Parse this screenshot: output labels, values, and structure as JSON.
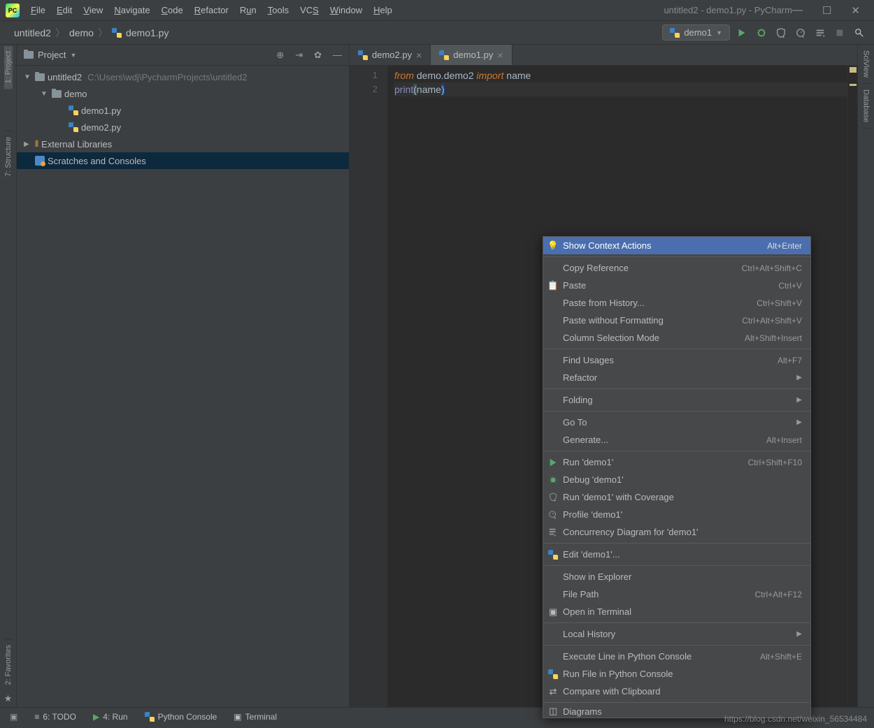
{
  "window": {
    "title": "untitled2 - demo1.py - PyCharm"
  },
  "menu": {
    "file": "File",
    "edit": "Edit",
    "view": "View",
    "navigate": "Navigate",
    "code": "Code",
    "refactor": "Refactor",
    "run": "Run",
    "tools": "Tools",
    "vcs": "VCS",
    "window": "Window",
    "help": "Help"
  },
  "breadcrumb": {
    "root": "untitled2",
    "folder": "demo",
    "file": "demo1.py"
  },
  "run_config": {
    "name": "demo1"
  },
  "project_panel": {
    "title": "Project"
  },
  "tree": {
    "root": "untitled2",
    "root_path": "C:\\Users\\wdj\\PycharmProjects\\untitled2",
    "demo": "demo",
    "file1": "demo1.py",
    "file2": "demo2.py",
    "ext_lib": "External Libraries",
    "scratches": "Scratches and Consoles"
  },
  "tabs": {
    "t1": "demo2.py",
    "t2": "demo1.py"
  },
  "code": {
    "line1_from": "from",
    "line1_module": " demo.demo2 ",
    "line1_import": "import",
    "line1_name": " name",
    "line2_print": "print",
    "line2_open": "(",
    "line2_arg": "name",
    "line2_close": ")"
  },
  "gutter": {
    "l1": "1",
    "l2": "2"
  },
  "left_tool": {
    "project": "1: Project",
    "structure": "7: Structure",
    "favorites": "2: Favorites"
  },
  "right_tool": {
    "sciview": "SciView",
    "database": "Database"
  },
  "context_menu": {
    "show_context": "Show Context Actions",
    "show_context_sc": "Alt+Enter",
    "copy_ref": "Copy Reference",
    "copy_ref_sc": "Ctrl+Alt+Shift+C",
    "paste": "Paste",
    "paste_sc": "Ctrl+V",
    "paste_hist": "Paste from History...",
    "paste_hist_sc": "Ctrl+Shift+V",
    "paste_wo": "Paste without Formatting",
    "paste_wo_sc": "Ctrl+Alt+Shift+V",
    "col_sel": "Column Selection Mode",
    "col_sel_sc": "Alt+Shift+Insert",
    "find_usages": "Find Usages",
    "find_usages_sc": "Alt+F7",
    "refactor": "Refactor",
    "folding": "Folding",
    "goto": "Go To",
    "generate": "Generate...",
    "generate_sc": "Alt+Insert",
    "run": "Run 'demo1'",
    "run_sc": "Ctrl+Shift+F10",
    "debug": "Debug 'demo1'",
    "coverage": "Run 'demo1' with Coverage",
    "profile": "Profile 'demo1'",
    "concurrency": "Concurrency Diagram for 'demo1'",
    "edit": "Edit 'demo1'...",
    "show_explorer": "Show in Explorer",
    "file_path": "File Path",
    "file_path_sc": "Ctrl+Alt+F12",
    "open_term": "Open in Terminal",
    "local_hist": "Local History",
    "exec_line": "Execute Line in Python Console",
    "exec_line_sc": "Alt+Shift+E",
    "run_file": "Run File in Python Console",
    "compare": "Compare with Clipboard",
    "diagrams": "Diagrams"
  },
  "bottom": {
    "todo": "6: TODO",
    "run": "4: Run",
    "console": "Python Console",
    "terminal": "Terminal"
  },
  "watermark": "https://blog.csdn.net/weixin_56534484"
}
